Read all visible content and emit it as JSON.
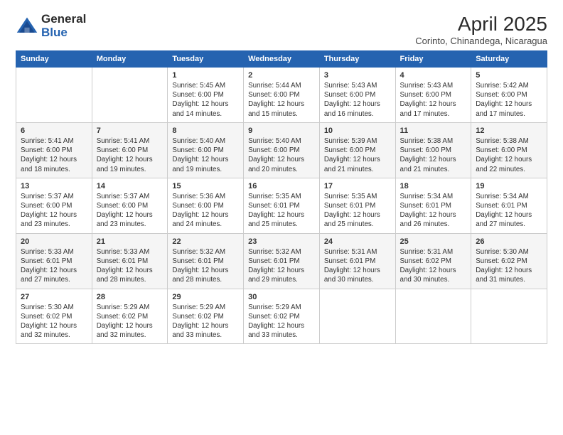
{
  "header": {
    "logo": {
      "general": "General",
      "blue": "Blue"
    },
    "title": "April 2025",
    "location": "Corinto, Chinandega, Nicaragua"
  },
  "calendar": {
    "days_of_week": [
      "Sunday",
      "Monday",
      "Tuesday",
      "Wednesday",
      "Thursday",
      "Friday",
      "Saturday"
    ],
    "weeks": [
      [
        {
          "day": "",
          "info": ""
        },
        {
          "day": "",
          "info": ""
        },
        {
          "day": "1",
          "info": "Sunrise: 5:45 AM\nSunset: 6:00 PM\nDaylight: 12 hours and 14 minutes."
        },
        {
          "day": "2",
          "info": "Sunrise: 5:44 AM\nSunset: 6:00 PM\nDaylight: 12 hours and 15 minutes."
        },
        {
          "day": "3",
          "info": "Sunrise: 5:43 AM\nSunset: 6:00 PM\nDaylight: 12 hours and 16 minutes."
        },
        {
          "day": "4",
          "info": "Sunrise: 5:43 AM\nSunset: 6:00 PM\nDaylight: 12 hours and 17 minutes."
        },
        {
          "day": "5",
          "info": "Sunrise: 5:42 AM\nSunset: 6:00 PM\nDaylight: 12 hours and 17 minutes."
        }
      ],
      [
        {
          "day": "6",
          "info": "Sunrise: 5:41 AM\nSunset: 6:00 PM\nDaylight: 12 hours and 18 minutes."
        },
        {
          "day": "7",
          "info": "Sunrise: 5:41 AM\nSunset: 6:00 PM\nDaylight: 12 hours and 19 minutes."
        },
        {
          "day": "8",
          "info": "Sunrise: 5:40 AM\nSunset: 6:00 PM\nDaylight: 12 hours and 19 minutes."
        },
        {
          "day": "9",
          "info": "Sunrise: 5:40 AM\nSunset: 6:00 PM\nDaylight: 12 hours and 20 minutes."
        },
        {
          "day": "10",
          "info": "Sunrise: 5:39 AM\nSunset: 6:00 PM\nDaylight: 12 hours and 21 minutes."
        },
        {
          "day": "11",
          "info": "Sunrise: 5:38 AM\nSunset: 6:00 PM\nDaylight: 12 hours and 21 minutes."
        },
        {
          "day": "12",
          "info": "Sunrise: 5:38 AM\nSunset: 6:00 PM\nDaylight: 12 hours and 22 minutes."
        }
      ],
      [
        {
          "day": "13",
          "info": "Sunrise: 5:37 AM\nSunset: 6:00 PM\nDaylight: 12 hours and 23 minutes."
        },
        {
          "day": "14",
          "info": "Sunrise: 5:37 AM\nSunset: 6:00 PM\nDaylight: 12 hours and 23 minutes."
        },
        {
          "day": "15",
          "info": "Sunrise: 5:36 AM\nSunset: 6:00 PM\nDaylight: 12 hours and 24 minutes."
        },
        {
          "day": "16",
          "info": "Sunrise: 5:35 AM\nSunset: 6:01 PM\nDaylight: 12 hours and 25 minutes."
        },
        {
          "day": "17",
          "info": "Sunrise: 5:35 AM\nSunset: 6:01 PM\nDaylight: 12 hours and 25 minutes."
        },
        {
          "day": "18",
          "info": "Sunrise: 5:34 AM\nSunset: 6:01 PM\nDaylight: 12 hours and 26 minutes."
        },
        {
          "day": "19",
          "info": "Sunrise: 5:34 AM\nSunset: 6:01 PM\nDaylight: 12 hours and 27 minutes."
        }
      ],
      [
        {
          "day": "20",
          "info": "Sunrise: 5:33 AM\nSunset: 6:01 PM\nDaylight: 12 hours and 27 minutes."
        },
        {
          "day": "21",
          "info": "Sunrise: 5:33 AM\nSunset: 6:01 PM\nDaylight: 12 hours and 28 minutes."
        },
        {
          "day": "22",
          "info": "Sunrise: 5:32 AM\nSunset: 6:01 PM\nDaylight: 12 hours and 28 minutes."
        },
        {
          "day": "23",
          "info": "Sunrise: 5:32 AM\nSunset: 6:01 PM\nDaylight: 12 hours and 29 minutes."
        },
        {
          "day": "24",
          "info": "Sunrise: 5:31 AM\nSunset: 6:01 PM\nDaylight: 12 hours and 30 minutes."
        },
        {
          "day": "25",
          "info": "Sunrise: 5:31 AM\nSunset: 6:02 PM\nDaylight: 12 hours and 30 minutes."
        },
        {
          "day": "26",
          "info": "Sunrise: 5:30 AM\nSunset: 6:02 PM\nDaylight: 12 hours and 31 minutes."
        }
      ],
      [
        {
          "day": "27",
          "info": "Sunrise: 5:30 AM\nSunset: 6:02 PM\nDaylight: 12 hours and 32 minutes."
        },
        {
          "day": "28",
          "info": "Sunrise: 5:29 AM\nSunset: 6:02 PM\nDaylight: 12 hours and 32 minutes."
        },
        {
          "day": "29",
          "info": "Sunrise: 5:29 AM\nSunset: 6:02 PM\nDaylight: 12 hours and 33 minutes."
        },
        {
          "day": "30",
          "info": "Sunrise: 5:29 AM\nSunset: 6:02 PM\nDaylight: 12 hours and 33 minutes."
        },
        {
          "day": "",
          "info": ""
        },
        {
          "day": "",
          "info": ""
        },
        {
          "day": "",
          "info": ""
        }
      ]
    ]
  }
}
